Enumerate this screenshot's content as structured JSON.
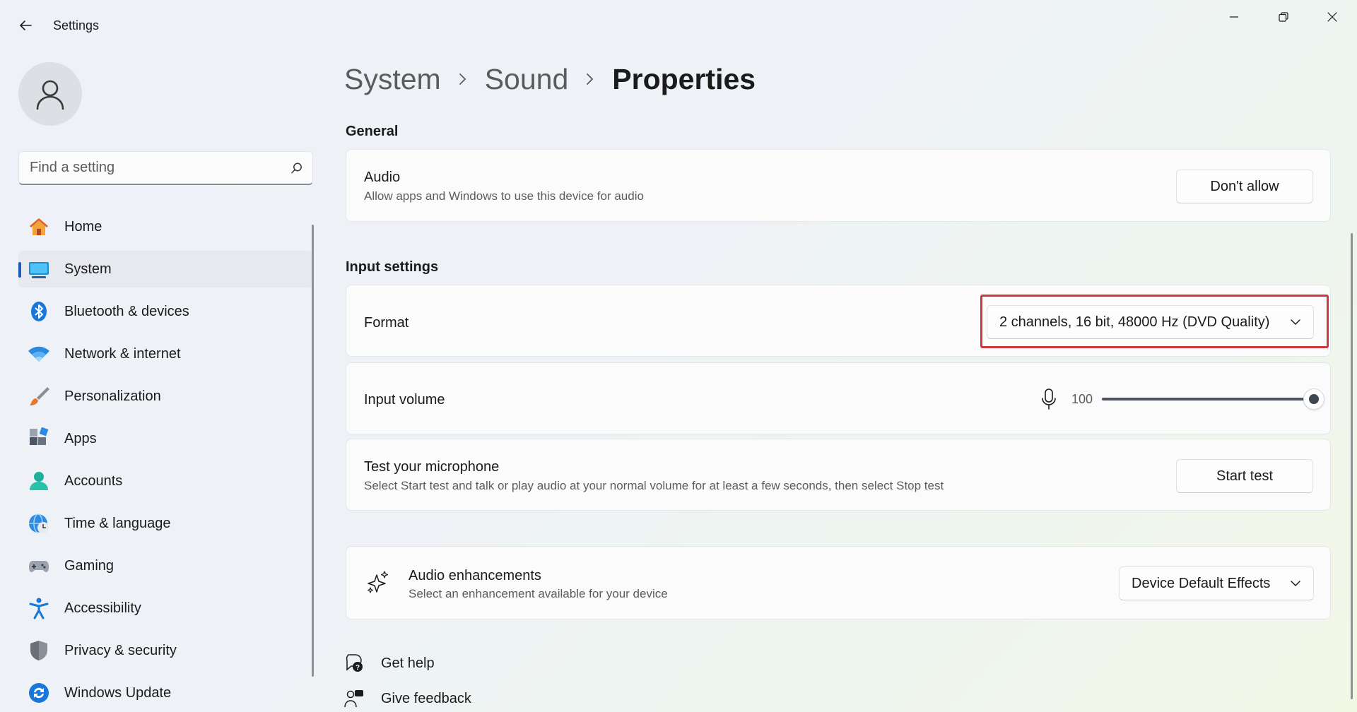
{
  "window": {
    "title": "Settings"
  },
  "user": {
    "avatar_icon": "person-icon"
  },
  "search": {
    "placeholder": "Find a setting"
  },
  "sidebar": {
    "items": [
      {
        "label": "Home",
        "icon": "home-icon",
        "selected": false
      },
      {
        "label": "System",
        "icon": "system-icon",
        "selected": true
      },
      {
        "label": "Bluetooth & devices",
        "icon": "bluetooth-icon",
        "selected": false
      },
      {
        "label": "Network & internet",
        "icon": "wifi-icon",
        "selected": false
      },
      {
        "label": "Personalization",
        "icon": "brush-icon",
        "selected": false
      },
      {
        "label": "Apps",
        "icon": "apps-icon",
        "selected": false
      },
      {
        "label": "Accounts",
        "icon": "accounts-icon",
        "selected": false
      },
      {
        "label": "Time & language",
        "icon": "globe-clock-icon",
        "selected": false
      },
      {
        "label": "Gaming",
        "icon": "gamepad-icon",
        "selected": false
      },
      {
        "label": "Accessibility",
        "icon": "accessibility-icon",
        "selected": false
      },
      {
        "label": "Privacy & security",
        "icon": "shield-icon",
        "selected": false
      },
      {
        "label": "Windows Update",
        "icon": "update-icon",
        "selected": false
      }
    ]
  },
  "breadcrumb": [
    "System",
    "Sound",
    "Properties"
  ],
  "general": {
    "title": "General",
    "audio": {
      "title": "Audio",
      "description": "Allow apps and Windows to use this device for audio",
      "button": "Don't allow"
    }
  },
  "input": {
    "title": "Input settings",
    "format": {
      "title": "Format",
      "selected": "2 channels, 16 bit, 48000 Hz (DVD Quality)",
      "highlight_color": "#d0343f"
    },
    "volume": {
      "title": "Input volume",
      "value": "100",
      "level_percent": 100,
      "icon": "microphone-icon"
    },
    "test": {
      "title": "Test your microphone",
      "description": "Select Start test and talk or play audio at your normal volume for at least a few seconds, then select Stop test",
      "button": "Start test"
    }
  },
  "enhancements": {
    "title": "Audio enhancements",
    "description": "Select an enhancement available for your device",
    "selected": "Device Default Effects",
    "icon": "sparkle-icon"
  },
  "help": {
    "get_help": "Get help",
    "give_feedback": "Give feedback"
  },
  "colors": {
    "accent": "#1d5db5",
    "highlight": "#d0343f"
  }
}
